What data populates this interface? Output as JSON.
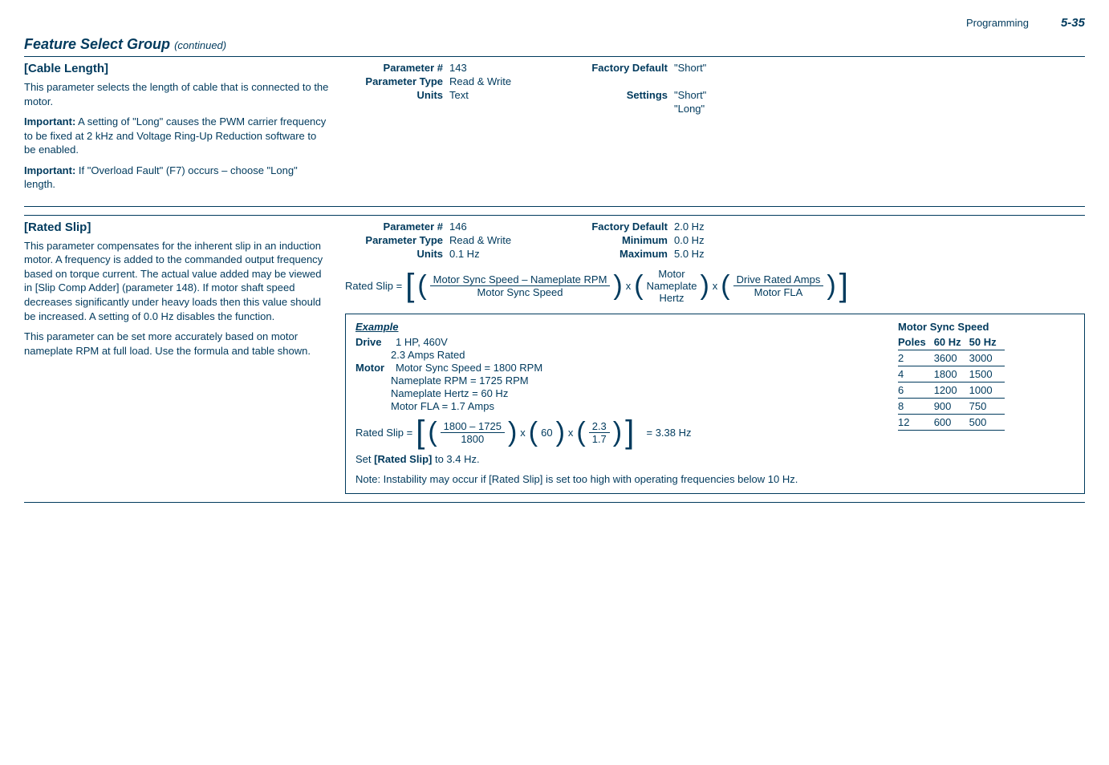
{
  "header": {
    "section": "Programming",
    "page": "5-35"
  },
  "group": {
    "title": "Feature Select Group",
    "continued": "(continued)"
  },
  "block1": {
    "name": "[Cable Length]",
    "desc1": "This parameter selects the length of cable that is connected to the motor.",
    "desc2_label": "Important:",
    "desc2": " A setting of \"Long\" causes the PWM carrier frequency to be fixed at 2 kHz and Voltage Ring-Up Reduction software to be enabled.",
    "desc3_label": "Important:",
    "desc3": " If \"Overload Fault\" (F7) occurs – choose \"Long\" length.",
    "params": {
      "number_lab": "Parameter #",
      "number": "143",
      "type_lab": "Parameter Type",
      "type": "Read & Write",
      "units_lab": "Units",
      "units": "Text",
      "fd_lab": "Factory Default",
      "fd": "\"Short\"",
      "set_lab": "Settings",
      "set1": "\"Short\"",
      "set2": "\"Long\""
    }
  },
  "block2": {
    "name": "[Rated Slip]",
    "desc1": "This parameter compensates for the inherent slip in an induction motor. A frequency is added to the commanded output frequency based on torque current. The actual value added may be viewed in [Slip Comp Adder] (parameter 148). If motor shaft speed decreases significantly under heavy loads then this value should be increased. A setting of 0.0 Hz disables the function.",
    "desc2": "This parameter can be set more accurately based on motor nameplate RPM at full load. Use the formula and table shown.",
    "params": {
      "number_lab": "Parameter #",
      "number": "146",
      "type_lab": "Parameter Type",
      "type": "Read & Write",
      "units_lab": "Units",
      "units": "0.1 Hz",
      "fd_lab": "Factory Default",
      "fd": "2.0 Hz",
      "min_lab": "Minimum",
      "min": "0.0 Hz",
      "max_lab": "Maximum",
      "max": "5.0 Hz"
    },
    "formula1": {
      "lhs": "Rated Slip  =",
      "f1_num": "Motor Sync Speed – Nameplate RPM",
      "f1_den": "Motor Sync Speed",
      "x": "x",
      "f2_top": "Motor",
      "f2_mid": "Nameplate",
      "f2_bot": "Hertz",
      "f3_num": "Drive Rated Amps",
      "f3_den": "Motor FLA"
    },
    "example": {
      "title": "Example",
      "drive_lab": "Drive",
      "drive_v": "1 HP, 460V",
      "drive_a": "2.3 Amps Rated",
      "motor_lab": "Motor",
      "m1": "Motor Sync Speed = 1800 RPM",
      "m2": "Nameplate RPM = 1725 RPM",
      "m3": "Nameplate Hertz = 60 Hz",
      "m4": "Motor FLA = 1.7 Amps",
      "lhs": "Rated Slip  =",
      "f1_num": "1800 – 1725",
      "f1_den": "1800",
      "x": "x",
      "sixty": "60",
      "f3_num": "2.3",
      "f3_den": "1.7",
      "result": "= 3.38 Hz",
      "set_line": "Set [Rated Slip] to 3.4 Hz.",
      "note": "Note: Instability may occur if [Rated Slip] is set too high with operating frequencies below 10 Hz."
    },
    "sync": {
      "caption": "Motor Sync Speed",
      "h1": "Poles",
      "h2": "60 Hz",
      "h3": "50 Hz",
      "rows": [
        [
          "2",
          "3600",
          "3000"
        ],
        [
          "4",
          "1800",
          "1500"
        ],
        [
          "6",
          "1200",
          "1000"
        ],
        [
          "8",
          "900",
          "750"
        ],
        [
          "12",
          "600",
          "500"
        ]
      ]
    }
  }
}
